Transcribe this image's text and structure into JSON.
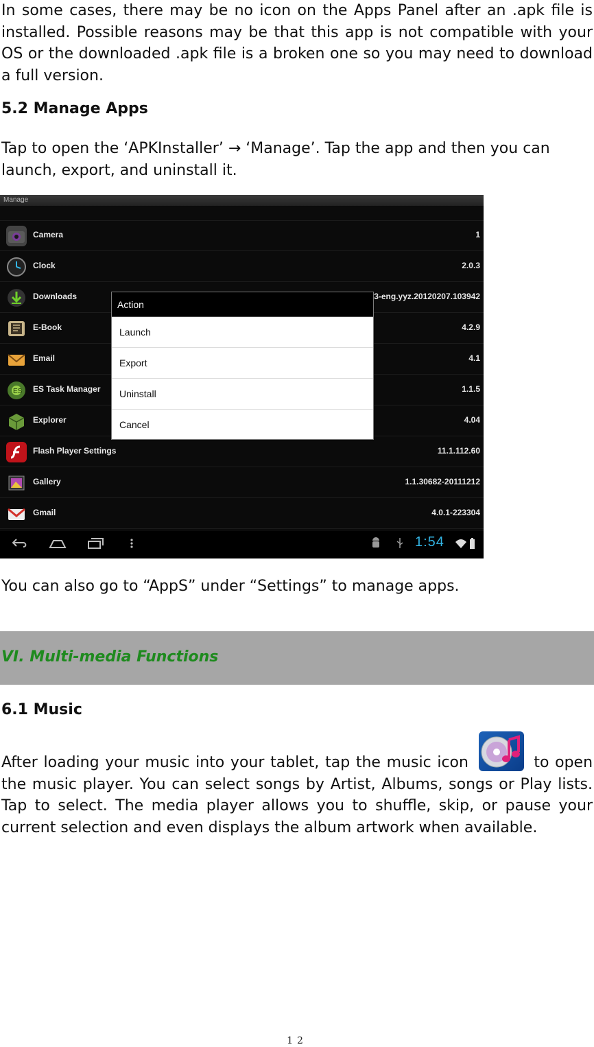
{
  "intro_paragraph": "In some cases, there may be no icon on the Apps Panel after an .apk file is installed. Possible reasons may be that this app is not compatible with your OS or the downloaded .apk file is a broken one so you may need to download a full version.",
  "section_5_2": {
    "heading": "5.2 Manage Apps",
    "text": "Tap to open the ‘APKInstaller’ → ‘Manage’. Tap the app and then you can launch, export, and uninstall it."
  },
  "screenshot": {
    "title": "Manage",
    "apps": [
      {
        "name": "Camera",
        "version": "1",
        "icon": "camera-icon"
      },
      {
        "name": "Clock",
        "version": "2.0.3",
        "icon": "clock-icon"
      },
      {
        "name": "Downloads",
        "version": "4.0.3-eng.yyz.20120207.103942",
        "icon": "download-icon"
      },
      {
        "name": "E-Book",
        "version": "4.2.9",
        "icon": "book-icon"
      },
      {
        "name": "Email",
        "version": "4.1",
        "icon": "email-icon"
      },
      {
        "name": "ES Task Manager",
        "version": "1.1.5",
        "icon": "task-manager-icon"
      },
      {
        "name": "Explorer",
        "version": "4.04",
        "icon": "explorer-icon"
      },
      {
        "name": "Flash Player Settings",
        "version": "11.1.112.60",
        "icon": "flash-icon"
      },
      {
        "name": "Gallery",
        "version": "1.1.30682-20111212",
        "icon": "gallery-icon"
      },
      {
        "name": "Gmail",
        "version": "4.0.1-223304",
        "icon": "gmail-icon"
      }
    ],
    "dialog": {
      "title": "Action",
      "items": [
        "Launch",
        "Export",
        "Uninstall",
        "Cancel"
      ]
    },
    "clock": "1:54",
    "colors": {
      "clock": "#33b5e5",
      "background": "#0b0b0b"
    }
  },
  "settings_note": "You can also go to “AppS” under “Settings” to manage apps.",
  "section_vi": {
    "title": "VI. Multi-media Functions",
    "color": "#1e8a1e",
    "band_color": "#a6a6a6"
  },
  "section_6_1": {
    "heading": "6.1 Music",
    "text_before_icon": "After loading your music into your tablet, tap the music icon",
    "text_after_icon": "to open the music player. You can select songs by Artist, Albums, songs or Play lists. Tap to select. The media player allows you to shuffle, skip, or pause your current selection and even displays the album artwork when available."
  },
  "page_number": "12"
}
